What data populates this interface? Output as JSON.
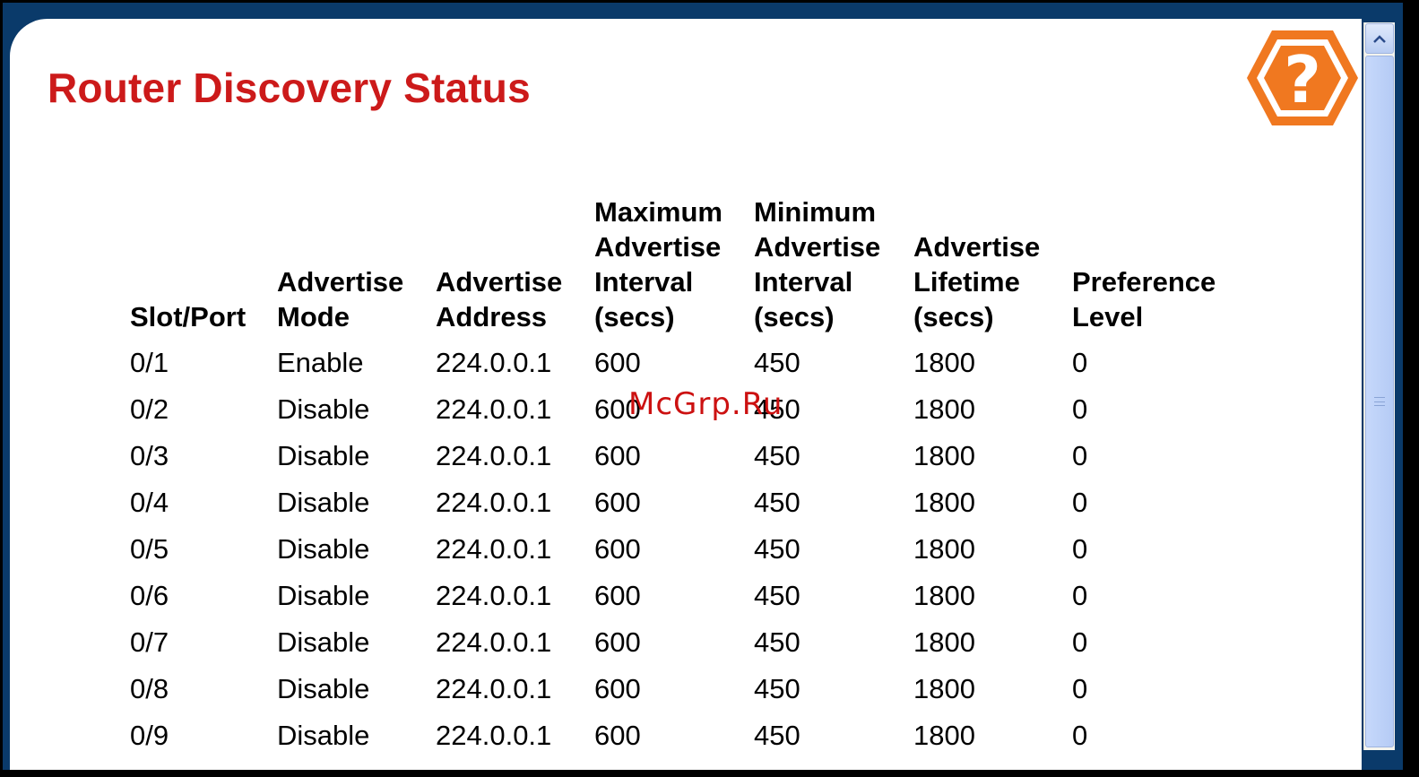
{
  "page": {
    "title": "Router Discovery Status"
  },
  "help": {
    "icon": "help-icon",
    "glyph": "?"
  },
  "table": {
    "headers": [
      "Slot/Port",
      "Advertise\nMode",
      "Advertise\nAddress",
      "Maximum\nAdvertise\nInterval\n(secs)",
      "Minimum\nAdvertise\nInterval\n(secs)",
      "Advertise\nLifetime\n(secs)",
      "Preference\nLevel"
    ],
    "rows": [
      [
        "0/1",
        "Enable",
        "224.0.0.1",
        "600",
        "450",
        "1800",
        "0"
      ],
      [
        "0/2",
        "Disable",
        "224.0.0.1",
        "600",
        "450",
        "1800",
        "0"
      ],
      [
        "0/3",
        "Disable",
        "224.0.0.1",
        "600",
        "450",
        "1800",
        "0"
      ],
      [
        "0/4",
        "Disable",
        "224.0.0.1",
        "600",
        "450",
        "1800",
        "0"
      ],
      [
        "0/5",
        "Disable",
        "224.0.0.1",
        "600",
        "450",
        "1800",
        "0"
      ],
      [
        "0/6",
        "Disable",
        "224.0.0.1",
        "600",
        "450",
        "1800",
        "0"
      ],
      [
        "0/7",
        "Disable",
        "224.0.0.1",
        "600",
        "450",
        "1800",
        "0"
      ],
      [
        "0/8",
        "Disable",
        "224.0.0.1",
        "600",
        "450",
        "1800",
        "0"
      ],
      [
        "0/9",
        "Disable",
        "224.0.0.1",
        "600",
        "450",
        "1800",
        "0"
      ]
    ]
  },
  "watermark": "McGrp.Ru",
  "colors": {
    "title": "#cc1a1a",
    "frame": "#0a3a6a",
    "help_orange": "#f07820"
  }
}
